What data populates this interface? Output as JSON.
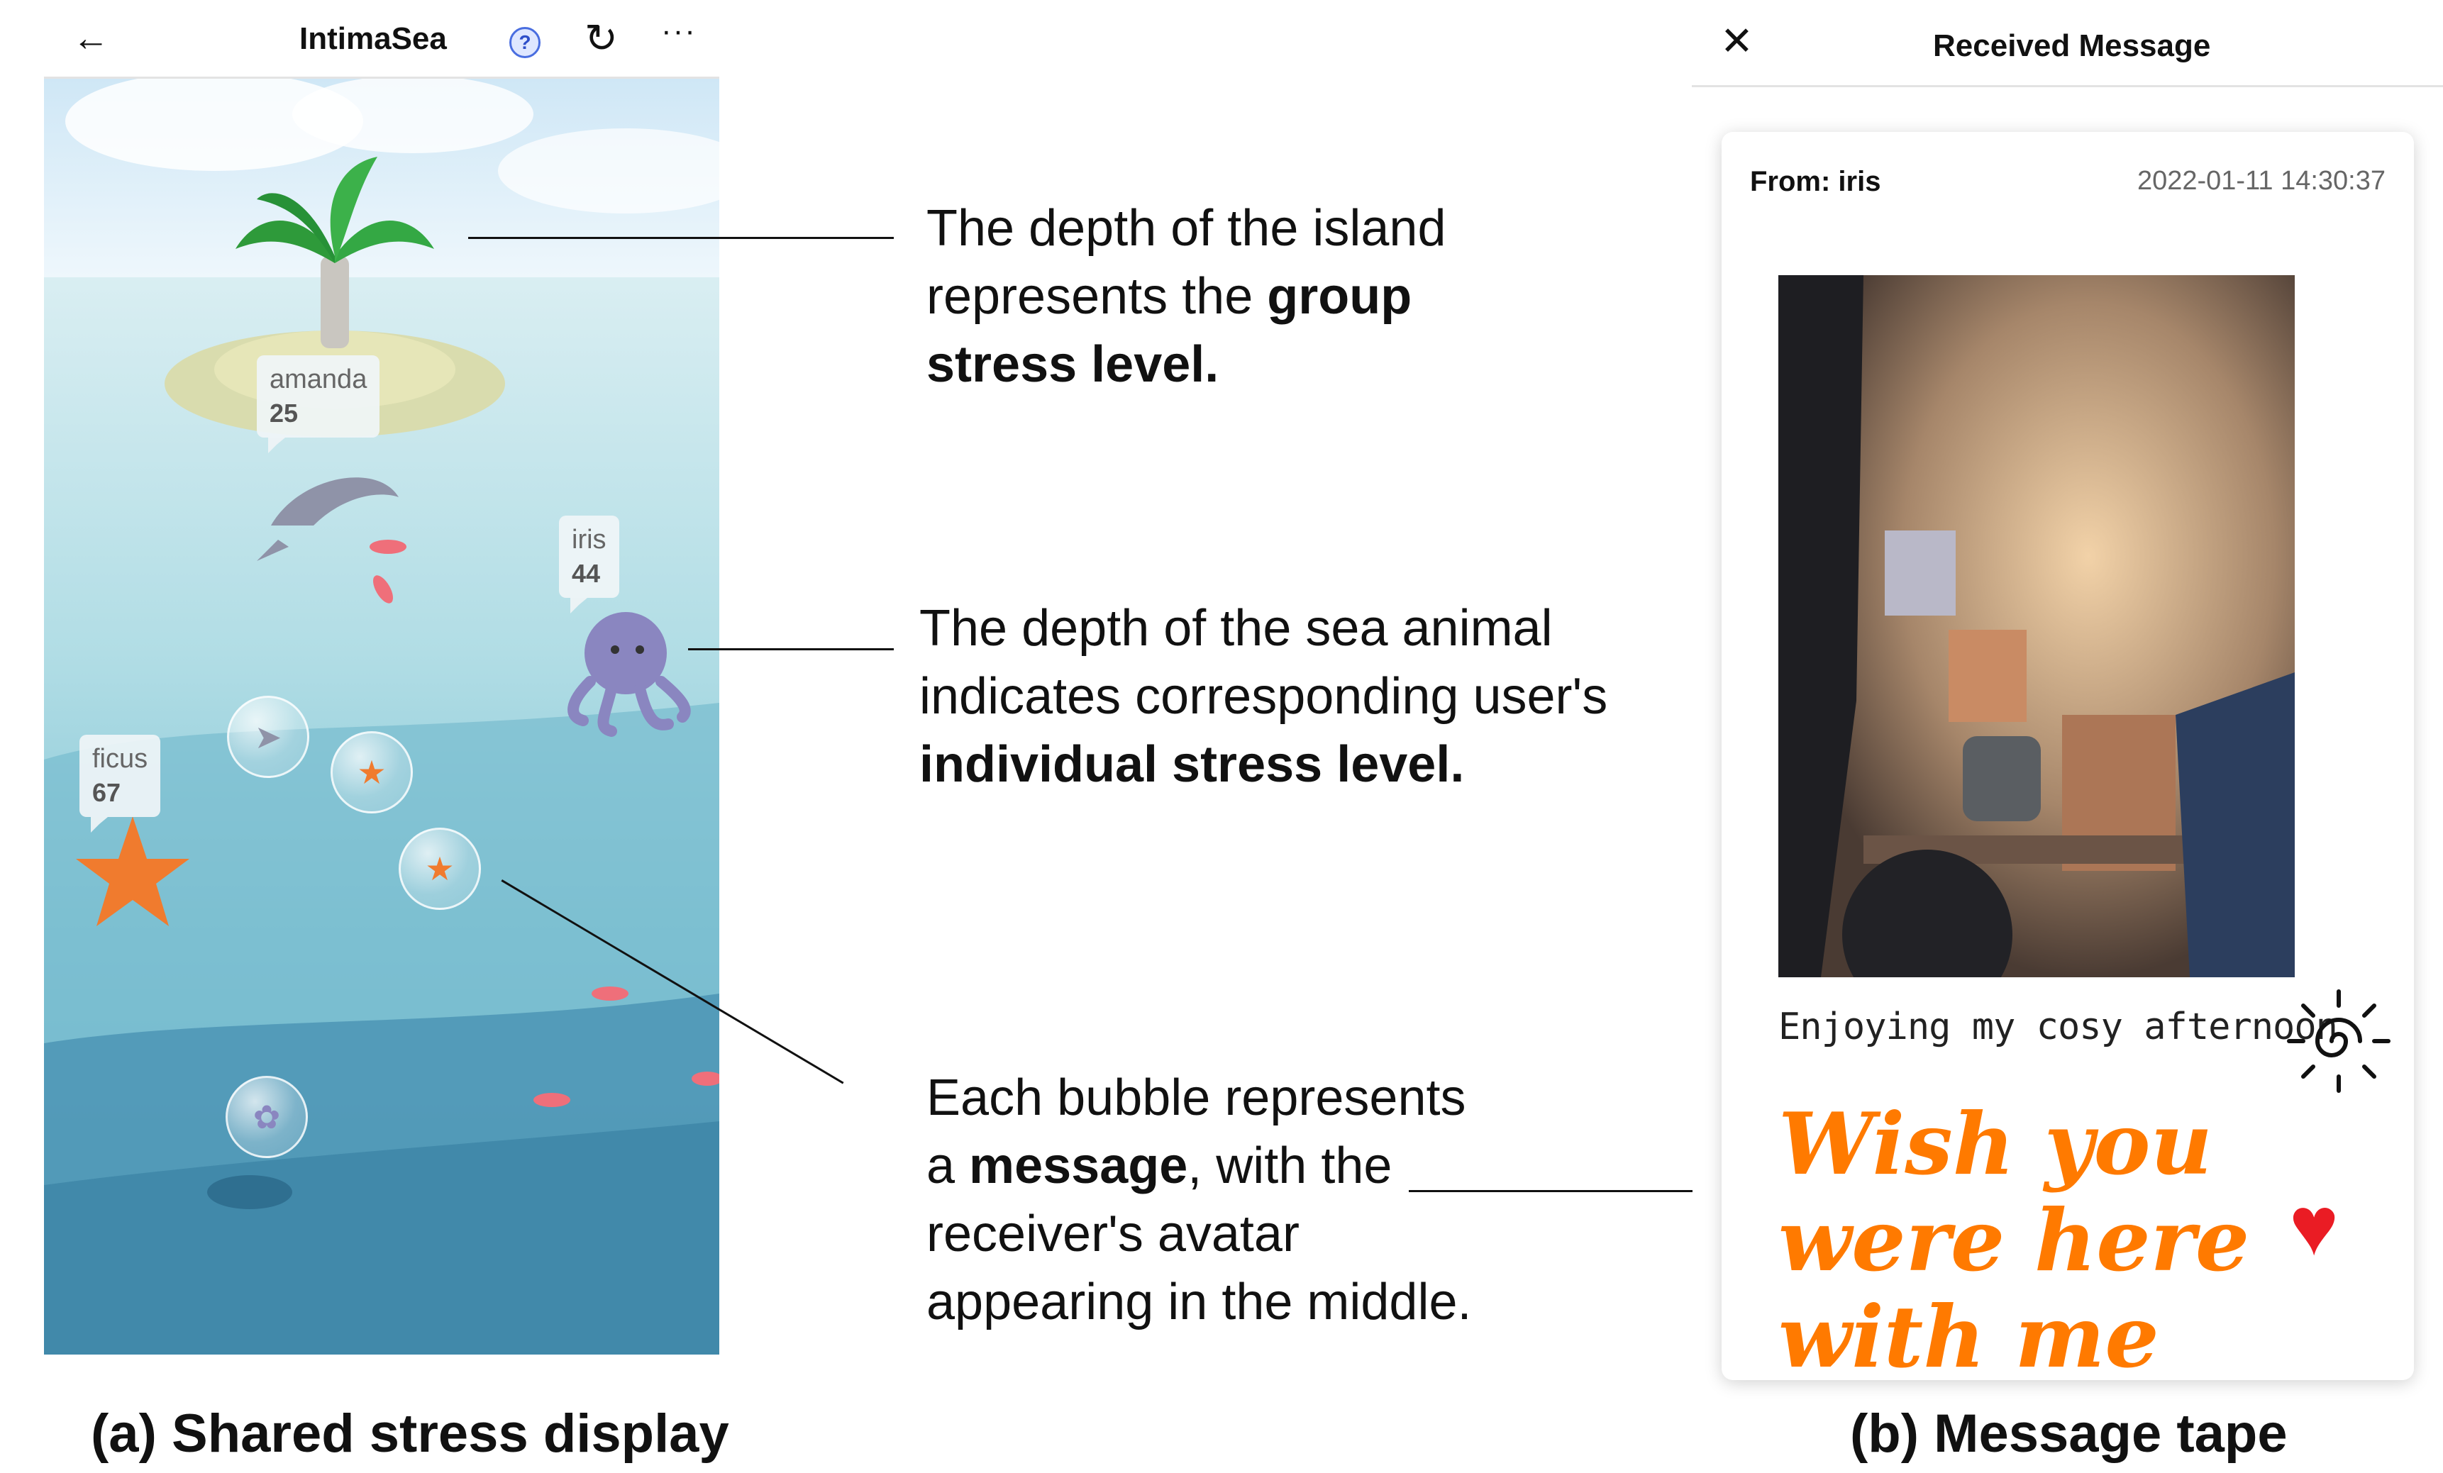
{
  "phone_a": {
    "back_icon": "arrow-left-icon",
    "app_title": "IntimaSea",
    "help_icon": "question-circle-icon",
    "refresh_icon": "refresh-icon",
    "more_icon": "ellipsis-icon",
    "users": [
      {
        "name": "amanda",
        "level": "25",
        "animal": "dolphin"
      },
      {
        "name": "iris",
        "level": "44",
        "animal": "octopus"
      },
      {
        "name": "ficus",
        "level": "67",
        "animal": "starfish"
      }
    ]
  },
  "annotations": {
    "island": {
      "pre": "The depth of the island represents the ",
      "bold": "group stress level."
    },
    "animal": {
      "pre": "The depth of the sea animal indicates corresponding user's ",
      "bold": "individual stress level."
    },
    "bubble": {
      "pre": "Each bubble represents a ",
      "bold": "message",
      "post": ", with the receiver's avatar appearing in the middle."
    }
  },
  "phone_b": {
    "close_icon": "close-icon",
    "title": "Received Message",
    "from": "From: iris",
    "timestamp": "2022-01-11 14:30:37",
    "caption": "Enjoying my cosy afternoon",
    "handwritten": "Wish you were here with me",
    "colors": {
      "handwriting": "#ff7a00",
      "heart": "#ea1c24"
    }
  },
  "figure_captions": {
    "a": "(a) Shared stress display",
    "b": "(b) Message tape"
  }
}
